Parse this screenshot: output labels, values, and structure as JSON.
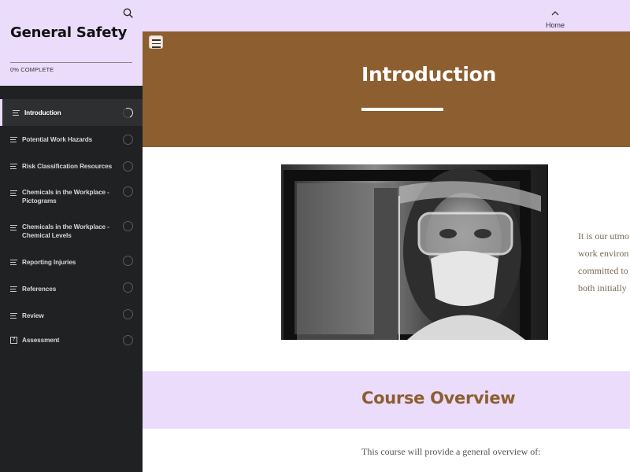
{
  "sidebar": {
    "course_title": "General Safety",
    "progress_label": "0% COMPLETE",
    "progress_fraction": 0,
    "items": [
      {
        "label": "Introduction",
        "icon": "lines-icon",
        "status": "in-progress"
      },
      {
        "label": "Potential Work Hazards",
        "icon": "lines-icon",
        "status": "not-started"
      },
      {
        "label": "Risk Classification Resources",
        "icon": "lines-icon",
        "status": "not-started"
      },
      {
        "label": "Chemicals in the Workplace - Pictograms",
        "icon": "lines-icon",
        "status": "not-started"
      },
      {
        "label": "Chemicals in the Workplace - Chemical Levels",
        "icon": "lines-icon",
        "status": "not-started"
      },
      {
        "label": "Reporting Injuries",
        "icon": "lines-icon",
        "status": "not-started"
      },
      {
        "label": "References",
        "icon": "lines-icon",
        "status": "not-started"
      },
      {
        "label": "Review",
        "icon": "lines-icon",
        "status": "not-started"
      },
      {
        "label": "Assessment",
        "icon": "quiz-icon",
        "status": "not-started"
      }
    ]
  },
  "topbar": {
    "home_label": "Home"
  },
  "hero": {
    "title": "Introduction"
  },
  "intro": {
    "lines": [
      "It is our utmo",
      "work environ",
      "committed to",
      "both initially"
    ]
  },
  "overview": {
    "title": "Course Overview",
    "body": "This course will provide a general overview of:"
  },
  "colors": {
    "accent_lavender": "#ebdcfb",
    "hero_brown": "#8c5e30",
    "sidebar_dark": "#1f2122"
  }
}
